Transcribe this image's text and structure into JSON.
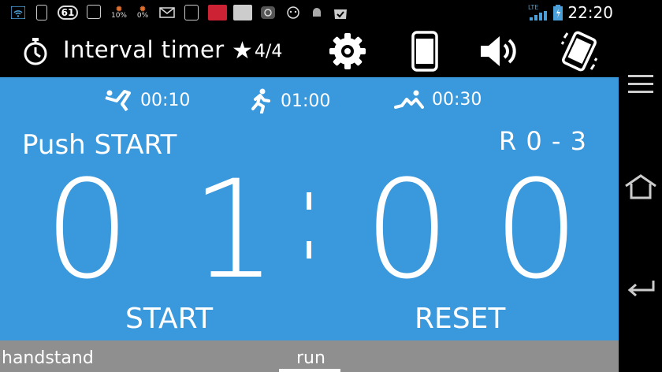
{
  "status_bar": {
    "notification_icons": [
      "wifi-icon",
      "phone-icon",
      "badge-61-icon",
      "app-icon",
      "battery-saver-icon",
      "cpu-icon",
      "gmail-icon",
      "clipboard-icon",
      "news-icon",
      "app-icon",
      "camera-icon",
      "app-icon",
      "android-icon",
      "shopping-icon"
    ],
    "badge_number": "61",
    "cpu_label_1": "10%",
    "cpu_label_2": "0%",
    "network_label": "LTE",
    "time": "22:20"
  },
  "app_bar": {
    "title": "Interval timer",
    "rating": "4/4",
    "actions": [
      "settings",
      "screen",
      "sound",
      "rotate"
    ]
  },
  "intervals": {
    "warmup": "00:10",
    "work": "01:00",
    "rest": "00:30"
  },
  "timer": {
    "status": "Push START",
    "round": "R 0 - 3",
    "digits": [
      "0",
      "1",
      "0",
      "0"
    ],
    "start_label": "START",
    "reset_label": "RESET"
  },
  "tabs": {
    "items": [
      "handstand",
      "run"
    ],
    "selected": "run"
  },
  "colors": {
    "primary": "#3a98dc",
    "tab_bar": "#8f8f8f",
    "background": "#000000"
  }
}
